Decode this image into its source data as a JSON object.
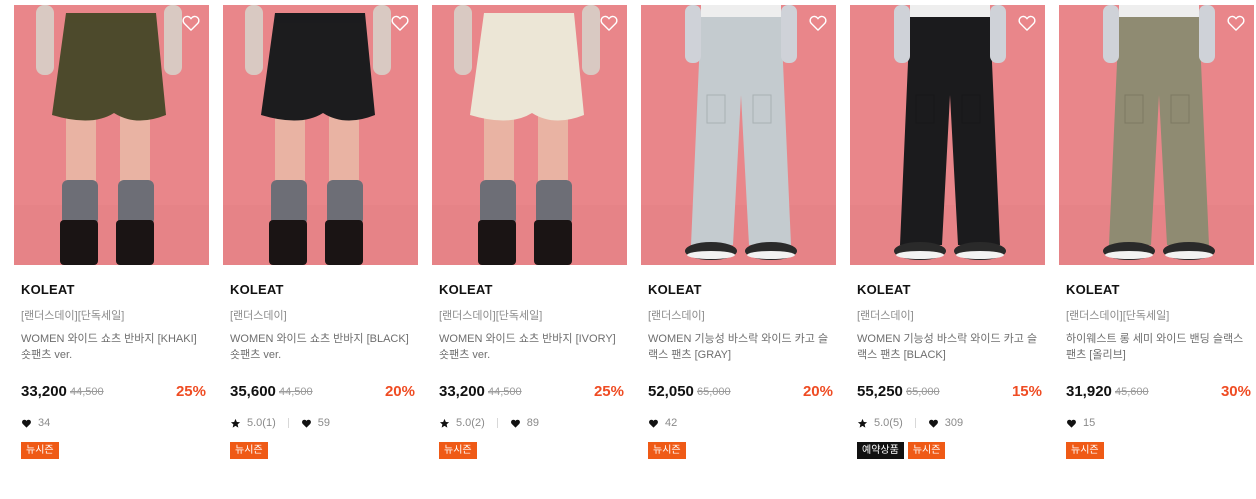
{
  "products": [
    {
      "brand": "KOLEAT",
      "tag": "[랜더스데이][단독세일]",
      "title": "WOMEN 와이드 쇼츠 반바지 [KHAKI] 숏팬츠 ver.",
      "price": "33,200",
      "original_price": "44,500",
      "discount": "25%",
      "rating": "",
      "likes": "34",
      "badges": [
        "뉴시즌"
      ],
      "garment_type": "shorts",
      "garment_color": "#4d4a2c",
      "liked": false
    },
    {
      "brand": "KOLEAT",
      "tag": "[랜더스데이]",
      "title": "WOMEN 와이드 쇼츠 반바지 [BLACK] 숏팬츠 ver.",
      "price": "35,600",
      "original_price": "44,500",
      "discount": "20%",
      "rating": "5.0(1)",
      "likes": "59",
      "badges": [
        "뉴시즌"
      ],
      "garment_type": "shorts",
      "garment_color": "#1c1c1e",
      "liked": false
    },
    {
      "brand": "KOLEAT",
      "tag": "[랜더스데이][단독세일]",
      "title": "WOMEN 와이드 쇼츠 반바지 [IVORY] 숏팬츠 ver.",
      "price": "33,200",
      "original_price": "44,500",
      "discount": "25%",
      "rating": "5.0(2)",
      "likes": "89",
      "badges": [
        "뉴시즌"
      ],
      "garment_type": "shorts",
      "garment_color": "#ece6d6",
      "liked": false
    },
    {
      "brand": "KOLEAT",
      "tag": "[랜더스데이]",
      "title": "WOMEN 기능성 바스락 와이드 카고 슬랙스 팬츠 [GRAY]",
      "price": "52,050",
      "original_price": "65,000",
      "discount": "20%",
      "rating": "",
      "likes": "42",
      "badges": [
        "뉴시즌"
      ],
      "garment_type": "pants",
      "garment_color": "#c4cbcf",
      "liked": false
    },
    {
      "brand": "KOLEAT",
      "tag": "[랜더스데이]",
      "title": "WOMEN 기능성 바스락 와이드 카고 슬랙스 팬츠 [BLACK]",
      "price": "55,250",
      "original_price": "65,000",
      "discount": "15%",
      "rating": "5.0(5)",
      "likes": "309",
      "badges": [
        "예약상품",
        "뉴시즌"
      ],
      "garment_type": "pants",
      "garment_color": "#1b1b1d",
      "liked": false
    },
    {
      "brand": "KOLEAT",
      "tag": "[랜더스데이][단독세일]",
      "title": "하이웨스트 롱 세미 와이드 밴딩 슬랙스 팬츠 [올리브]",
      "price": "31,920",
      "original_price": "45,600",
      "discount": "30%",
      "rating": "",
      "likes": "15",
      "badges": [
        "뉴시즌"
      ],
      "garment_type": "pants",
      "garment_color": "#8f8b72",
      "liked": false
    }
  ],
  "colors": {
    "discount": "#ef4c23",
    "badge_new_season": "#ef5a16",
    "badge_preorder": "#111111",
    "photo_background": "#e9868a"
  },
  "icons": {
    "wishlist": "heart-outline-icon",
    "likes": "heart-filled-icon",
    "rating": "star-icon"
  }
}
